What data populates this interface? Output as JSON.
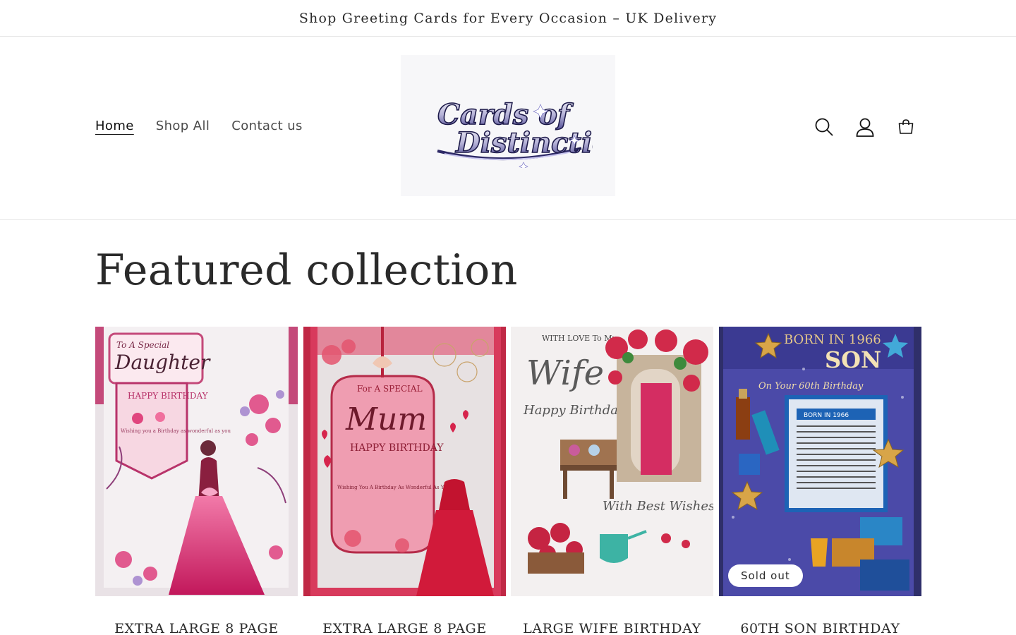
{
  "announcement": {
    "text": "Shop Greeting Cards for Every Occasion – UK Delivery"
  },
  "nav": {
    "items": [
      {
        "label": "Home",
        "active": true
      },
      {
        "label": "Shop All"
      },
      {
        "label": "Contact us"
      }
    ]
  },
  "logo": {
    "text_line1": "Cards of",
    "text_line2": "Distinction"
  },
  "header_icons": [
    "search-icon",
    "account-icon",
    "cart-icon"
  ],
  "section": {
    "title": "Featured collection"
  },
  "products": [
    {
      "title": "EXTRA LARGE 8 PAGE",
      "card_text": {
        "top": "To A Special",
        "main": "Daughter",
        "sub": "HAPPY BIRTHDAY",
        "small": "Wishing you a Birthday as wonderful as you"
      }
    },
    {
      "title": "EXTRA LARGE 8 PAGE",
      "card_text": {
        "top": "For A SPECIAL",
        "main": "Mum",
        "sub": "HAPPY BIRTHDAY",
        "small": "Wishing You A Birthday As Wonderful As You"
      }
    },
    {
      "title": "LARGE WIFE BIRTHDAY",
      "card_text": {
        "top": "WITH LOVE To My",
        "main": "Wife",
        "sub": "Happy Birthday",
        "small": "With Best Wishes"
      }
    },
    {
      "title": "60TH SON BIRTHDAY",
      "badge": "Sold out",
      "card_text": {
        "top": "BORN IN 1966",
        "main": "SON",
        "sub": "On Your 60th Birthday",
        "small": "BORN IN 1966"
      }
    }
  ],
  "colors": {
    "accent": "#121212",
    "badge_bg": "#ffffff"
  }
}
